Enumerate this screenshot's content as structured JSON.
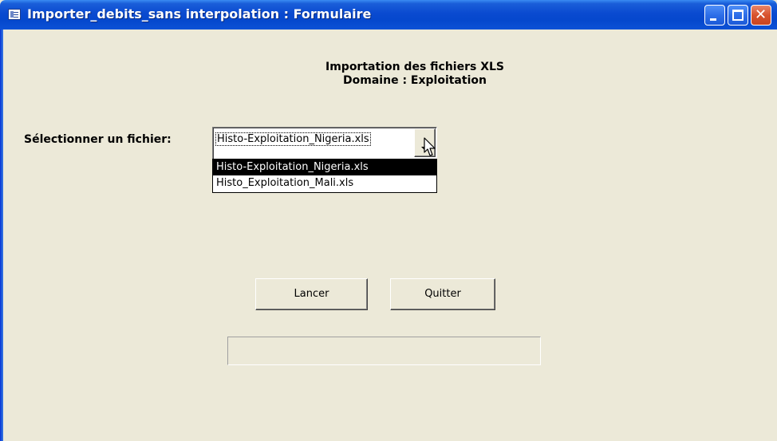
{
  "window": {
    "title": "Importer_debits_sans interpolation : Formulaire",
    "controls": {
      "minimize": "minimize-icon",
      "maximize": "maximize-icon",
      "close": "close-icon"
    },
    "colors": {
      "titlebar": "#0a4ad0",
      "face": "#ece9d8",
      "close": "#d8532e"
    }
  },
  "form": {
    "heading_line1": "Importation des fichiers XLS",
    "heading_line2": "Domaine : Exploitation",
    "file_label": "Sélectionner un fichier:",
    "combo": {
      "value": "Histo-Exploitation_Nigeria.xls",
      "options": [
        {
          "label": "Histo-Exploitation_Nigeria.xls",
          "selected": true
        },
        {
          "label": "Histo_Exploitation_Mali.xls",
          "selected": false
        }
      ]
    },
    "buttons": {
      "launch": "Lancer",
      "quit": "Quitter"
    },
    "status_text": ""
  }
}
